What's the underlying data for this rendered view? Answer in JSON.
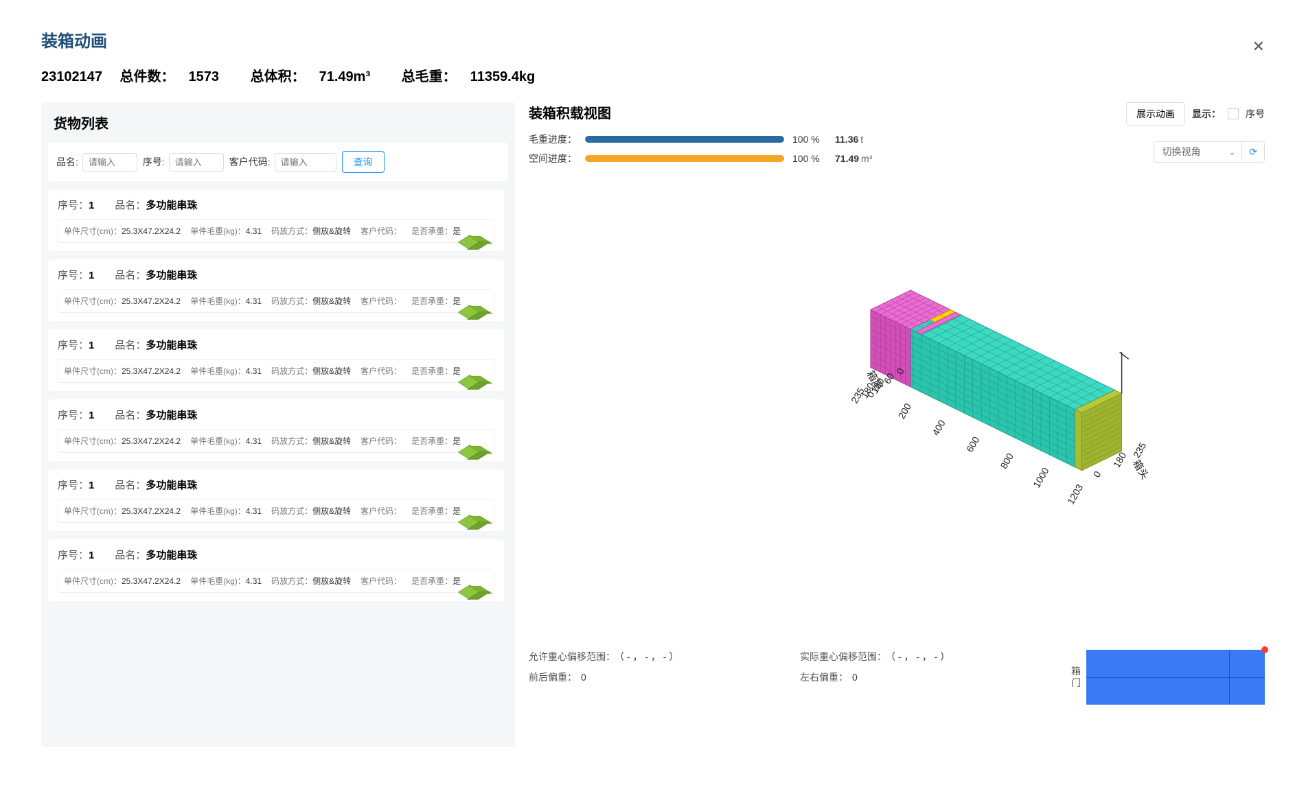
{
  "modal": {
    "title": "装箱动画",
    "close": "✕"
  },
  "summary": {
    "order_no": "23102147",
    "total_pieces_label": "总件数：",
    "total_pieces": "1573",
    "total_volume_label": "总体积：",
    "total_volume": "71.49m³",
    "total_gw_label": "总毛重：",
    "total_gw": "11359.4kg"
  },
  "left": {
    "title": "货物列表",
    "search": {
      "name_label": "品名:",
      "name_placeholder": "请输入",
      "seq_label": "序号:",
      "seq_placeholder": "请输入",
      "cust_label": "客户代码:",
      "cust_placeholder": "请输入",
      "query_btn": "查询"
    },
    "card_labels": {
      "seq": "序号：",
      "name": "品名：",
      "dim": "单件尺寸(cm)：",
      "gw": "单件毛重(kg)：",
      "stack": "码放方式：",
      "cust": "客户代码：",
      "bear": "是否承重："
    },
    "cards": [
      {
        "seq": "1",
        "name": "多功能串珠",
        "dim": "25.3X47.2X24.2",
        "gw": "4.31",
        "stack": "侧放&旋转",
        "cust": "",
        "bear": "是"
      },
      {
        "seq": "1",
        "name": "多功能串珠",
        "dim": "25.3X47.2X24.2",
        "gw": "4.31",
        "stack": "侧放&旋转",
        "cust": "",
        "bear": "是"
      },
      {
        "seq": "1",
        "name": "多功能串珠",
        "dim": "25.3X47.2X24.2",
        "gw": "4.31",
        "stack": "侧放&旋转",
        "cust": "",
        "bear": "是"
      },
      {
        "seq": "1",
        "name": "多功能串珠",
        "dim": "25.3X47.2X24.2",
        "gw": "4.31",
        "stack": "侧放&旋转",
        "cust": "",
        "bear": "是"
      },
      {
        "seq": "1",
        "name": "多功能串珠",
        "dim": "25.3X47.2X24.2",
        "gw": "4.31",
        "stack": "侧放&旋转",
        "cust": "",
        "bear": "是"
      },
      {
        "seq": "1",
        "name": "多功能串珠",
        "dim": "25.3X47.2X24.2",
        "gw": "4.31",
        "stack": "侧放&旋转",
        "cust": "",
        "bear": "是"
      }
    ]
  },
  "right": {
    "title": "装箱积载视图",
    "anim_btn": "展示动画",
    "show_label": "显示：",
    "seq_label": "序号",
    "select_placeholder": "切换视角",
    "gw_progress": {
      "label": "毛重进度：",
      "pct": "100",
      "pct_unit": "%",
      "val": "11.36",
      "unit": "t",
      "color": "#2b6aa3"
    },
    "space_progress": {
      "label": "空间进度：",
      "pct": "100",
      "pct_unit": "%",
      "val": "71.49",
      "unit": "m³",
      "color": "#f5a623"
    }
  },
  "axes": {
    "depth_label": "箱尾",
    "head_label": "箱头",
    "depth_ticks": [
      "0",
      "60",
      "120",
      "180",
      "235"
    ],
    "length_ticks": [
      "0",
      "200",
      "400",
      "600",
      "800",
      "1000",
      "1203"
    ],
    "width_ticks": [
      "0",
      "180",
      "235"
    ]
  },
  "bottom": {
    "allow_range_label": "允许重心偏移范围：",
    "allow_range_val": "（ - ， - ， - ）",
    "fb_offset_label": "前后偏重：",
    "fb_offset_val": "0",
    "actual_range_label": "实际重心偏移范围：",
    "actual_range_val": "（ - ， - ， - ）",
    "lr_offset_label": "左右偏重：",
    "lr_offset_val": "0",
    "minimap_label1": "箱",
    "minimap_label2": "门"
  }
}
